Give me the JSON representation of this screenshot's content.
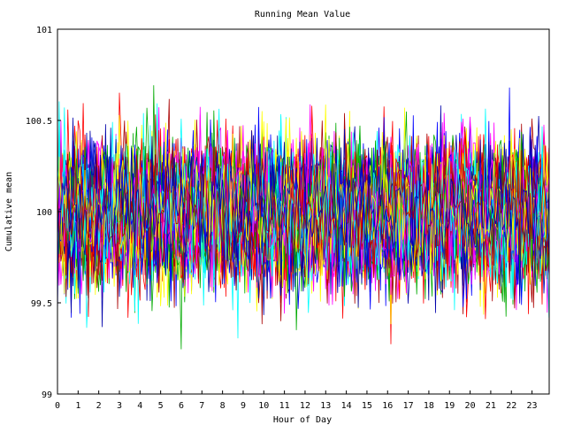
{
  "chart_data": {
    "type": "line",
    "title": "Running Mean Value",
    "xlabel": "Hour of Day",
    "ylabel": "Cumulative mean",
    "xlim": [
      0,
      23.833
    ],
    "ylim": [
      99,
      101
    ],
    "x_ticks": [
      "0",
      "1",
      "2",
      "3",
      "4",
      "5",
      "6",
      "7",
      "8",
      "9",
      "10",
      "11",
      "12",
      "13",
      "14",
      "15",
      "16",
      "17",
      "18",
      "19",
      "20",
      "21",
      "22",
      "23"
    ],
    "y_ticks": [
      "99",
      "99.5",
      "100",
      "100.5",
      "101"
    ],
    "x_step_hours": 0.0833,
    "center": 100,
    "noise_std": 0.2,
    "series_count": 64,
    "series_colors": [
      "#ff0000",
      "#00aa00",
      "#0000ff",
      "#ff00ff",
      "#00ffff",
      "#ffff00",
      "#aa0000",
      "#0000aa"
    ],
    "grid": false,
    "legend": "none"
  }
}
